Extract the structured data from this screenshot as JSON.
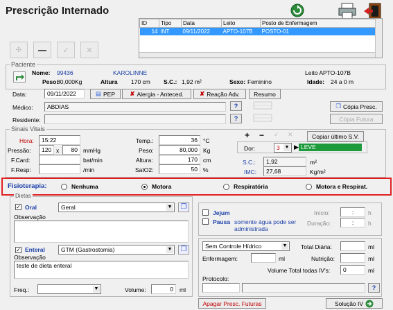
{
  "title": "Prescrição Internado",
  "grid": {
    "headers": [
      "ID",
      "Tipo",
      "Data",
      "Leito",
      "Posto de Enfermagem"
    ],
    "rows": [
      [
        "14",
        "INT",
        "09/11/2022",
        "APTO-107B",
        "POSTO-01"
      ]
    ]
  },
  "patient": {
    "group_label": "Paciente",
    "name_label": "Nome:",
    "id": "99436",
    "name": "KAROLINNE",
    "leito": "Leito APTO-107B",
    "peso_label": "Peso:",
    "peso": "80,000Kg",
    "altura_label": "Altura",
    "altura": "170 cm",
    "sc_label": "S.C.:",
    "sc": "1,92 m²",
    "sexo_label": "Sexo:",
    "sexo": "Feminino",
    "idade_label": "Idade:",
    "idade": "24 a 0 m"
  },
  "header_form": {
    "data_label": "Data:",
    "data": "09/11/2022",
    "pep": "PEP",
    "alergia": "Alergia - Anteced.",
    "reacao": "Reação Adv.",
    "resumo": "Resumo",
    "medico_label": "Médico:",
    "medico": "ABDIAS",
    "residente_label": "Residente:",
    "residente": "",
    "copia_presc": "Cópia Presc.",
    "copia_futura": "Cópia Futura"
  },
  "vitals": {
    "group_label": "Sinais Vitais",
    "hora_label": "Hora:",
    "hora": "15:22",
    "pressao_label": "Pressão:",
    "pressao_a": "120",
    "pressao_x": "x",
    "pressao_b": "80",
    "pressao_unit": "mmHg",
    "fcard_label": "F.Card:",
    "fcard": "",
    "fcard_unit": "bat/min",
    "fresp_label": "F.Resp:",
    "fresp": "",
    "fresp_unit": "/min",
    "temp_label": "Temp.:",
    "temp": "36",
    "temp_unit": "°C",
    "peso_label": "Peso:",
    "peso": "80,000",
    "peso_unit": "Kg",
    "altura_label": "Altura:",
    "altura": "170",
    "altura_unit": "cm",
    "sato2_label": "SatO2:",
    "sato2": "50",
    "sato2_unit": "%",
    "copiar_ultimo": "Copiar último S.V.",
    "dor_label": "Dor:",
    "dor_value": "3",
    "dor_level": "LEVE",
    "sc_label": "S.C.:",
    "sc": "1,92",
    "sc_unit": "m²",
    "imc_label": "IMC:",
    "imc": "27,68",
    "imc_unit": "Kg/m²",
    "plus": "+",
    "minus": "−"
  },
  "fisioterapia": {
    "label": "Fisioterapia:",
    "options": [
      "Nenhuma",
      "Motora",
      "Respiratória",
      "Motora e Respirat."
    ],
    "selected": 1
  },
  "dietas": {
    "group_label": "Dietas",
    "oral_label": "Oral",
    "oral_value": "Geral",
    "observacao_label": "Observação",
    "oral_obs": "",
    "enteral_label": "Enteral",
    "enteral_value": "GTM (Gastrostomia)",
    "enteral_obs": "teste de dieta enteral",
    "freq_label": "Freq.:",
    "freq_value": "",
    "volume_label": "Volume:",
    "volume": "0",
    "volume_unit": "ml"
  },
  "jejum": {
    "jejum_label": "Jejum",
    "pausa_label": "Pausa",
    "pausa_text": "somente água pode ser administrada",
    "inicio_label": "Início:",
    "inicio": ":",
    "inicio_unit": "h",
    "duracao_label": "Duração:",
    "duracao": ":",
    "duracao_unit": "h"
  },
  "hidrico": {
    "controle": "Sem Controle Hídrico",
    "total_diaria_label": "Total Diária:",
    "total_diaria": "",
    "total_unit": "ml",
    "enfermagem_label": "Enfermagem:",
    "enfermagem": "",
    "enfermagem_unit": "ml",
    "nutricao_label": "Nutrição:",
    "nutricao": "",
    "nutricao_unit": "ml",
    "volume_total_label": "Volume Total todas IV's:",
    "volume_total": "0",
    "volume_total_unit": "ml",
    "protocolo_label": "Protocolo:",
    "protocolo": ""
  },
  "footer": {
    "apagar": "Apagar Presc. Futuras",
    "solucao": "Solução IV"
  }
}
